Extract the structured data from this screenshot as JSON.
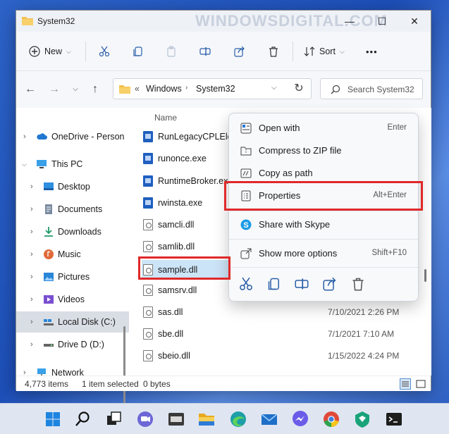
{
  "window": {
    "title": "System32",
    "watermark": "WINDOWSDIGITAL.COM",
    "controls": [
      "—",
      "☐",
      "✕"
    ]
  },
  "toolbar": {
    "new_label": "New",
    "sort_label": "Sort",
    "more": "•••"
  },
  "address": {
    "prefix": "«",
    "crumbs": [
      "Windows",
      "System32"
    ]
  },
  "search": {
    "placeholder": "Search System32"
  },
  "sidebar": {
    "items": [
      {
        "label": "OneDrive - Person"
      },
      {
        "label": "This PC"
      },
      {
        "label": "Desktop"
      },
      {
        "label": "Documents"
      },
      {
        "label": "Downloads"
      },
      {
        "label": "Music"
      },
      {
        "label": "Pictures"
      },
      {
        "label": "Videos"
      },
      {
        "label": "Local Disk (C:)"
      },
      {
        "label": "Drive D (D:)"
      },
      {
        "label": "Network"
      }
    ]
  },
  "list": {
    "column_name": "Name",
    "files": [
      {
        "name": "RunLegacyCPLElev",
        "date": ""
      },
      {
        "name": "runonce.exe",
        "date": ""
      },
      {
        "name": "RuntimeBroker.exe",
        "date": ""
      },
      {
        "name": "rwinsta.exe",
        "date": ""
      },
      {
        "name": "samcli.dll",
        "date": ""
      },
      {
        "name": "samlib.dll",
        "date": ""
      },
      {
        "name": "sample.dll",
        "date": ""
      },
      {
        "name": "samsrv.dll",
        "date": ""
      },
      {
        "name": "sas.dll",
        "date": "7/10/2021 2:26 PM"
      },
      {
        "name": "sbe.dll",
        "date": "7/1/2021 7:10 AM"
      },
      {
        "name": "sbeio.dll",
        "date": "1/15/2022 4:24 PM"
      }
    ]
  },
  "status": {
    "count": "4,773 items",
    "selected": "1 item selected",
    "size": "0 bytes"
  },
  "context_menu": {
    "items": [
      {
        "label": "Open with",
        "shortcut": "Enter"
      },
      {
        "label": "Compress to ZIP file",
        "shortcut": ""
      },
      {
        "label": "Copy as path",
        "shortcut": ""
      },
      {
        "label": "Properties",
        "shortcut": "Alt+Enter"
      },
      {
        "label": "Share with Skype",
        "shortcut": ""
      },
      {
        "label": "Show more options",
        "shortcut": "Shift+F10"
      }
    ],
    "icon_row": [
      "cut-icon",
      "copy-icon",
      "rename-icon",
      "share-icon",
      "delete-icon"
    ]
  },
  "taskbar": {
    "icons": [
      "start-icon",
      "search-icon",
      "task-view-icon",
      "teams-chat-icon",
      "widgets-icon",
      "file-explorer-icon",
      "edge-icon",
      "mail-icon",
      "messenger-icon",
      "chrome-icon",
      "security-icon",
      "terminal-icon"
    ]
  },
  "colors": {
    "highlight": "#e0282a",
    "accent": "#1a66d6",
    "folder": "#f2c14e"
  }
}
